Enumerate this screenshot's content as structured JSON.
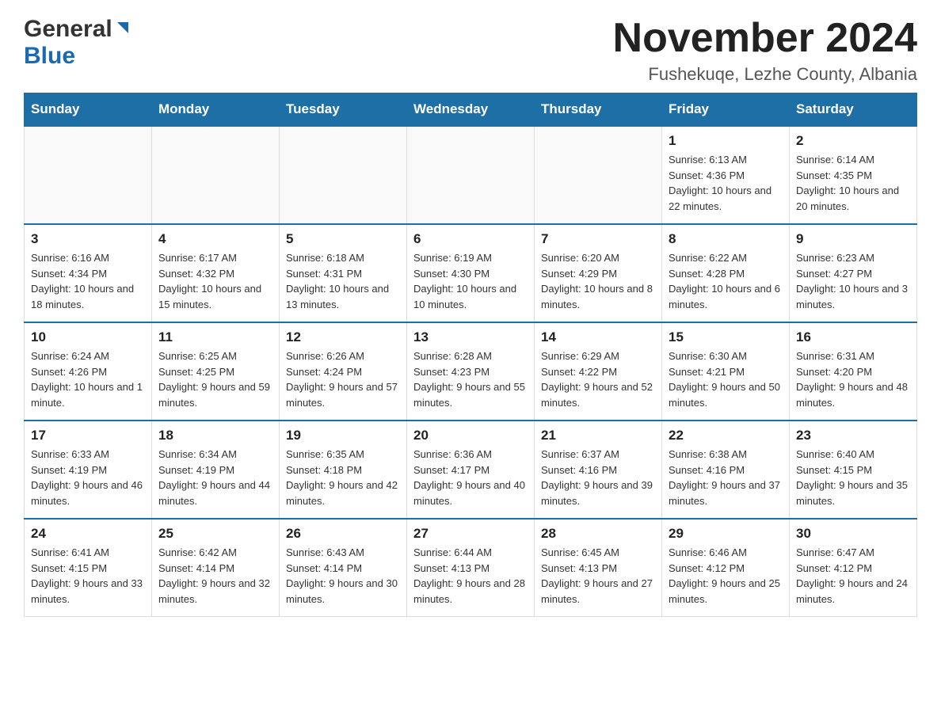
{
  "header": {
    "logo": {
      "general": "General",
      "blue": "Blue",
      "triangle": "▶"
    },
    "title": "November 2024",
    "subtitle": "Fushekuqe, Lezhe County, Albania"
  },
  "calendar": {
    "weekdays": [
      "Sunday",
      "Monday",
      "Tuesday",
      "Wednesday",
      "Thursday",
      "Friday",
      "Saturday"
    ],
    "weeks": [
      [
        {
          "day": "",
          "info": ""
        },
        {
          "day": "",
          "info": ""
        },
        {
          "day": "",
          "info": ""
        },
        {
          "day": "",
          "info": ""
        },
        {
          "day": "",
          "info": ""
        },
        {
          "day": "1",
          "info": "Sunrise: 6:13 AM\nSunset: 4:36 PM\nDaylight: 10 hours and 22 minutes."
        },
        {
          "day": "2",
          "info": "Sunrise: 6:14 AM\nSunset: 4:35 PM\nDaylight: 10 hours and 20 minutes."
        }
      ],
      [
        {
          "day": "3",
          "info": "Sunrise: 6:16 AM\nSunset: 4:34 PM\nDaylight: 10 hours and 18 minutes."
        },
        {
          "day": "4",
          "info": "Sunrise: 6:17 AM\nSunset: 4:32 PM\nDaylight: 10 hours and 15 minutes."
        },
        {
          "day": "5",
          "info": "Sunrise: 6:18 AM\nSunset: 4:31 PM\nDaylight: 10 hours and 13 minutes."
        },
        {
          "day": "6",
          "info": "Sunrise: 6:19 AM\nSunset: 4:30 PM\nDaylight: 10 hours and 10 minutes."
        },
        {
          "day": "7",
          "info": "Sunrise: 6:20 AM\nSunset: 4:29 PM\nDaylight: 10 hours and 8 minutes."
        },
        {
          "day": "8",
          "info": "Sunrise: 6:22 AM\nSunset: 4:28 PM\nDaylight: 10 hours and 6 minutes."
        },
        {
          "day": "9",
          "info": "Sunrise: 6:23 AM\nSunset: 4:27 PM\nDaylight: 10 hours and 3 minutes."
        }
      ],
      [
        {
          "day": "10",
          "info": "Sunrise: 6:24 AM\nSunset: 4:26 PM\nDaylight: 10 hours and 1 minute."
        },
        {
          "day": "11",
          "info": "Sunrise: 6:25 AM\nSunset: 4:25 PM\nDaylight: 9 hours and 59 minutes."
        },
        {
          "day": "12",
          "info": "Sunrise: 6:26 AM\nSunset: 4:24 PM\nDaylight: 9 hours and 57 minutes."
        },
        {
          "day": "13",
          "info": "Sunrise: 6:28 AM\nSunset: 4:23 PM\nDaylight: 9 hours and 55 minutes."
        },
        {
          "day": "14",
          "info": "Sunrise: 6:29 AM\nSunset: 4:22 PM\nDaylight: 9 hours and 52 minutes."
        },
        {
          "day": "15",
          "info": "Sunrise: 6:30 AM\nSunset: 4:21 PM\nDaylight: 9 hours and 50 minutes."
        },
        {
          "day": "16",
          "info": "Sunrise: 6:31 AM\nSunset: 4:20 PM\nDaylight: 9 hours and 48 minutes."
        }
      ],
      [
        {
          "day": "17",
          "info": "Sunrise: 6:33 AM\nSunset: 4:19 PM\nDaylight: 9 hours and 46 minutes."
        },
        {
          "day": "18",
          "info": "Sunrise: 6:34 AM\nSunset: 4:19 PM\nDaylight: 9 hours and 44 minutes."
        },
        {
          "day": "19",
          "info": "Sunrise: 6:35 AM\nSunset: 4:18 PM\nDaylight: 9 hours and 42 minutes."
        },
        {
          "day": "20",
          "info": "Sunrise: 6:36 AM\nSunset: 4:17 PM\nDaylight: 9 hours and 40 minutes."
        },
        {
          "day": "21",
          "info": "Sunrise: 6:37 AM\nSunset: 4:16 PM\nDaylight: 9 hours and 39 minutes."
        },
        {
          "day": "22",
          "info": "Sunrise: 6:38 AM\nSunset: 4:16 PM\nDaylight: 9 hours and 37 minutes."
        },
        {
          "day": "23",
          "info": "Sunrise: 6:40 AM\nSunset: 4:15 PM\nDaylight: 9 hours and 35 minutes."
        }
      ],
      [
        {
          "day": "24",
          "info": "Sunrise: 6:41 AM\nSunset: 4:15 PM\nDaylight: 9 hours and 33 minutes."
        },
        {
          "day": "25",
          "info": "Sunrise: 6:42 AM\nSunset: 4:14 PM\nDaylight: 9 hours and 32 minutes."
        },
        {
          "day": "26",
          "info": "Sunrise: 6:43 AM\nSunset: 4:14 PM\nDaylight: 9 hours and 30 minutes."
        },
        {
          "day": "27",
          "info": "Sunrise: 6:44 AM\nSunset: 4:13 PM\nDaylight: 9 hours and 28 minutes."
        },
        {
          "day": "28",
          "info": "Sunrise: 6:45 AM\nSunset: 4:13 PM\nDaylight: 9 hours and 27 minutes."
        },
        {
          "day": "29",
          "info": "Sunrise: 6:46 AM\nSunset: 4:12 PM\nDaylight: 9 hours and 25 minutes."
        },
        {
          "day": "30",
          "info": "Sunrise: 6:47 AM\nSunset: 4:12 PM\nDaylight: 9 hours and 24 minutes."
        }
      ]
    ]
  }
}
